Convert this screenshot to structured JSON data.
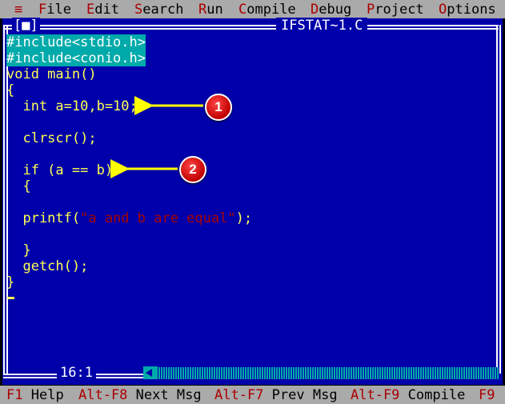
{
  "menu": {
    "items": [
      {
        "hot": "≡",
        "rest": ""
      },
      {
        "hot": "F",
        "rest": "ile"
      },
      {
        "hot": "E",
        "rest": "dit"
      },
      {
        "hot": "S",
        "rest": "earch"
      },
      {
        "hot": "R",
        "rest": "un"
      },
      {
        "hot": "C",
        "rest": "ompile"
      },
      {
        "hot": "D",
        "rest": "ebug"
      },
      {
        "hot": "P",
        "rest": "roject"
      },
      {
        "hot": "O",
        "rest": "ptions"
      }
    ]
  },
  "editor": {
    "close_box": "[■]",
    "title": "IFSTAT~1.C",
    "cursor_position": "16:1",
    "lines": {
      "l1": "#include<stdio.h>",
      "l2": "#include<conio.h>",
      "l3": "void main()",
      "l4": "{",
      "l5": "  int a=10,b=10;",
      "l7": "  clrscr();",
      "l9": "  if (a == b)",
      "l10": "  {",
      "l12a": "  printf(",
      "l12b": "\"a and b are equal\"",
      "l12c": ");",
      "l14": "  }",
      "l15": "  getch();",
      "l16": "}"
    }
  },
  "annotations": {
    "badge1": "1",
    "badge2": "2"
  },
  "statusbar": {
    "f1_key": "F1",
    "f1_label": "Help",
    "altf8_key": "Alt-F8",
    "altf8_label": "Next Msg",
    "altf7_key": "Alt-F7",
    "altf7_label": "Prev Msg",
    "altf9_key": "Alt-F9",
    "altf9_label": "Compile",
    "f9_key": "F9"
  },
  "colors": {
    "editor_bg": "#0000aa",
    "menu_bg": "#aaaaaa",
    "hotkey": "#aa0000",
    "code_text": "#ffff55",
    "preprocessor_bg": "#00aaaa",
    "badge": "#d40000",
    "arrow": "#ffff00"
  }
}
